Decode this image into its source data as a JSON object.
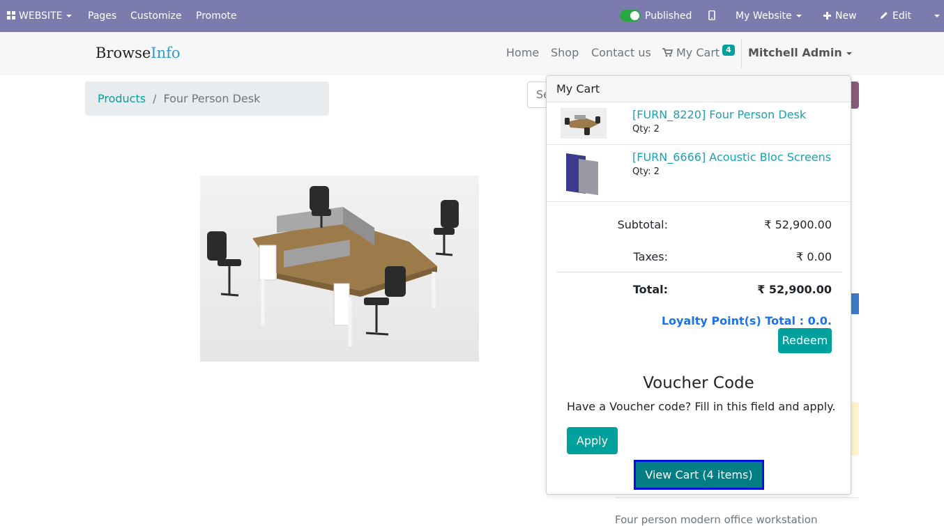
{
  "admin_bar": {
    "website_menu": "WEBSITE",
    "pages": "Pages",
    "customize": "Customize",
    "promote": "Promote",
    "publish_status": "Published",
    "website_selector": "My Website",
    "new": "New",
    "edit": "Edit"
  },
  "header": {
    "logo_part1": "Browse",
    "logo_part2": "Info",
    "nav": [
      "Home",
      "Shop",
      "Contact us"
    ],
    "cart_label": "My Cart",
    "cart_count": "4",
    "user": "Mitchell Admin"
  },
  "breadcrumb": {
    "parent": "Products",
    "separator": "/",
    "current": "Four Person Desk"
  },
  "search": {
    "placeholder_partial": "Se"
  },
  "product": {
    "description_partial": "Four person modern office workstation"
  },
  "cart_popover": {
    "title": "My Cart",
    "lines": [
      {
        "name": "[FURN_8220] Four Person Desk",
        "qty": "Qty: 2"
      },
      {
        "name": "[FURN_6666] Acoustic Bloc Screens",
        "qty": "Qty: 2"
      }
    ],
    "subtotal_label": "Subtotal:",
    "subtotal_value": "₹ 52,900.00",
    "taxes_label": "Taxes:",
    "taxes_value": "₹ 0.00",
    "total_label": "Total:",
    "total_value": "₹ 52,900.00",
    "loyalty_text": "Loyalty Point(s) Total : 0.0.",
    "redeem": "Redeem",
    "voucher_title": "Voucher Code",
    "voucher_text": "Have a Voucher code? Fill in this field and apply.",
    "apply": "Apply",
    "view_cart": "View Cart (4 items)"
  },
  "colors": {
    "admin_bar": "#7c7bad",
    "accent_teal": "#00a09d",
    "view_cart_bg": "#017e84",
    "focus_outline": "#0011dd",
    "loyalty_blue": "#1a73e8",
    "published_toggle": "#28a745"
  }
}
